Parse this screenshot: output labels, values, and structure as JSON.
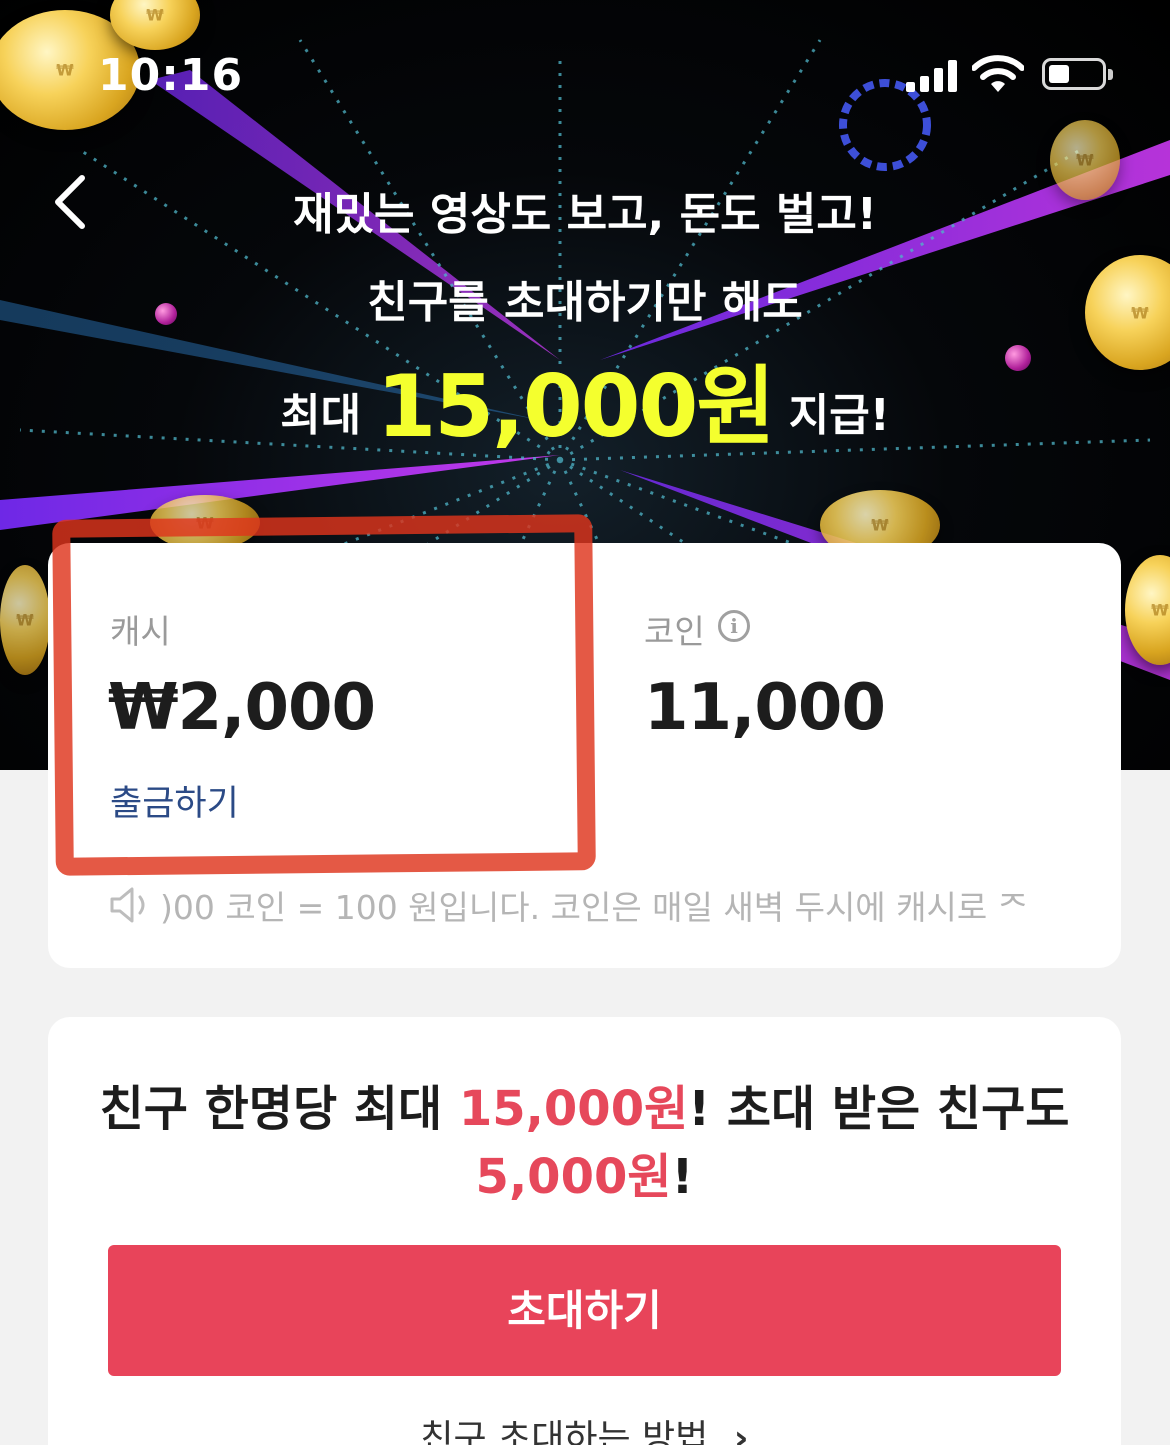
{
  "status_bar": {
    "time": "10:16"
  },
  "banner": {
    "line1": "재밌는 영상도 보고, 돈도 벌고!",
    "line2": "친구를 초대하기만 해도",
    "line3_prefix": "최대 ",
    "line3_amount": "15,000원",
    "line3_suffix": " 지급!",
    "accent_color": "#f4ff2e"
  },
  "balance": {
    "cash_label": "캐시",
    "cash_value": "₩2,000",
    "withdraw_label": "출금하기",
    "coin_label": "코인",
    "coin_value": "11,000",
    "notice": ")00 코인 = 100 원입니다. 코인은 매일 새벽 두시에 캐시로 ᄌ"
  },
  "invite": {
    "text_a": "친구 한명당 최대 ",
    "amount_a": "15,000원",
    "text_b": "! 초대 받은 친구도 ",
    "amount_b": "5,000원",
    "text_c": "!",
    "button_label": "초대하기",
    "how_label": "친구 초대하는 방법",
    "accent_color": "#e8445a"
  }
}
